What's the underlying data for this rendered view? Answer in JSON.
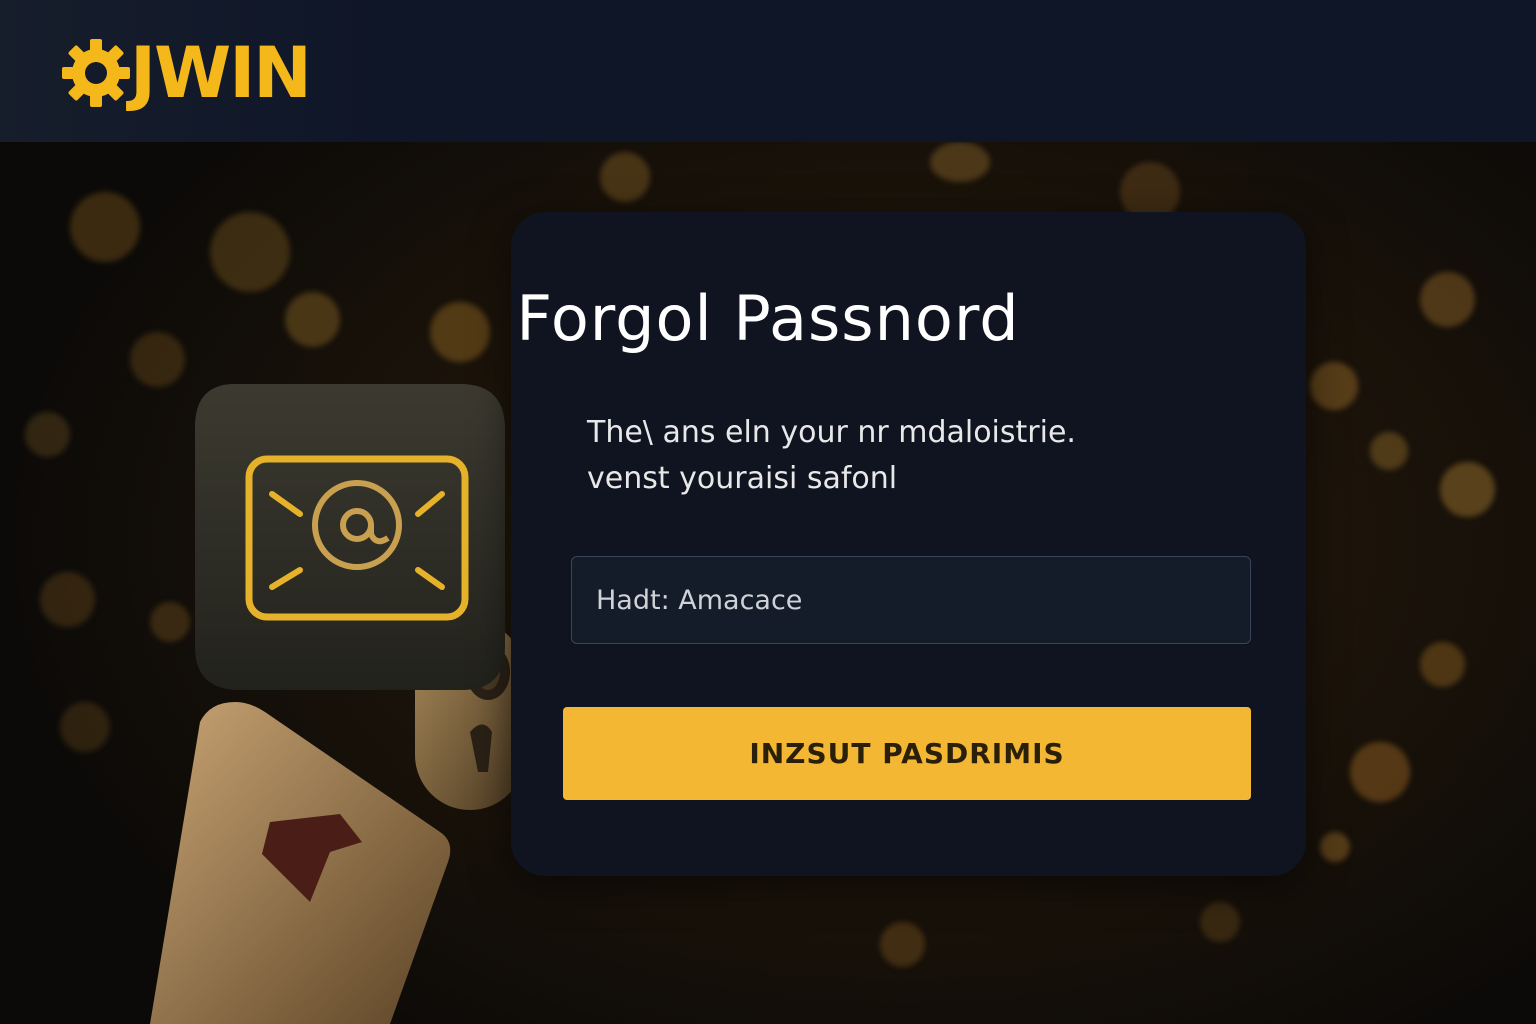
{
  "brand": {
    "name": "JWIN",
    "accent_color": "#f5b81a",
    "icon": "gear-icon"
  },
  "form": {
    "title": "Forgol Passnord",
    "description_line1": "The\\ ans eln your nr mdaloistrie.",
    "description_line2": "venst youraisi safonl",
    "input_placeholder": "Hadt: Amacace",
    "submit_label": "INZSUT PASDRIMIS",
    "button_color": "#f4b733"
  },
  "illustration": {
    "icons": [
      "email-icon",
      "at-sign-icon",
      "padlock-icon",
      "card-icon"
    ]
  }
}
